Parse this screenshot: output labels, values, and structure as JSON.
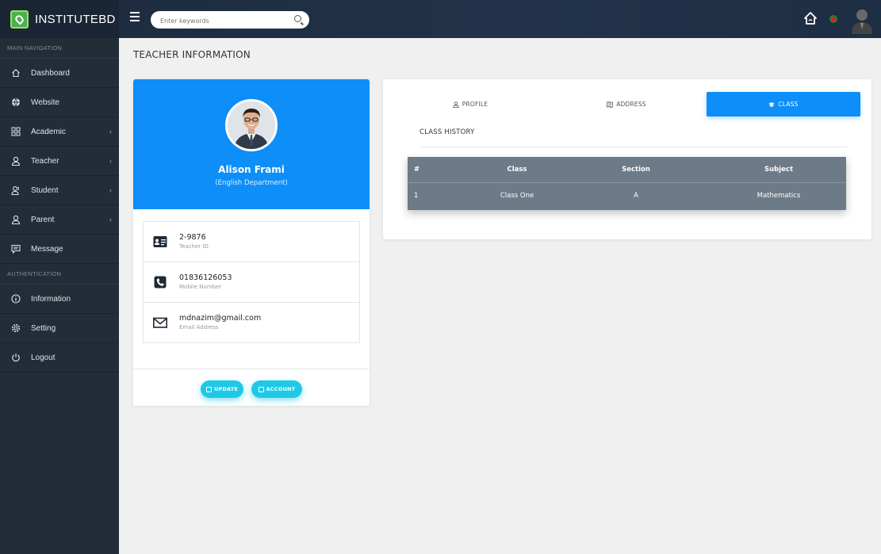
{
  "header": {
    "brand": "INSTITUTEBD",
    "search_placeholder": "Enter keywords",
    "colors": {
      "bar": "#1d2b3c",
      "flag_green": "#2e7d32",
      "flag_red": "#c62828"
    }
  },
  "sidebar": {
    "sections": [
      "MAIN NAVIGATION",
      "AUTHENTICATION"
    ],
    "items": [
      {
        "label": "Dashboard",
        "icon": "home-icon"
      },
      {
        "label": "Website",
        "icon": "globe-icon"
      },
      {
        "label": "Academic",
        "icon": "grid-icon",
        "expandable": true
      },
      {
        "label": "Teacher",
        "icon": "user-icon",
        "expandable": true
      },
      {
        "label": "Student",
        "icon": "users-icon",
        "expandable": true
      },
      {
        "label": "Parent",
        "icon": "user-icon",
        "expandable": true
      },
      {
        "label": "Message",
        "icon": "message-icon"
      },
      {
        "label": "Information",
        "icon": "info-icon"
      },
      {
        "label": "Setting",
        "icon": "gear-icon"
      },
      {
        "label": "Logout",
        "icon": "power-icon"
      }
    ]
  },
  "page": {
    "title": "TEACHER INFORMATION"
  },
  "profile": {
    "name": "Alison Frami",
    "department": "(English Department)",
    "teacher_id": "2-9876",
    "teacher_id_label": "Teacher ID",
    "mobile": "01836126053",
    "mobile_label": "Mobile Number",
    "email": "mdnazim@gmail.com",
    "email_label": "Email Address",
    "update_label": "UPDATE",
    "account_label": "ACCOUNT",
    "accent": "#0d8ef8",
    "button_color": "#1ec9e6"
  },
  "tabs": {
    "items": [
      {
        "label": "PROFILE",
        "icon": "user-icon"
      },
      {
        "label": "ADDRESS",
        "icon": "map-icon"
      },
      {
        "label": "CLASS",
        "icon": "graduation-icon",
        "active": true
      }
    ]
  },
  "class_history": {
    "title": "CLASS HISTORY",
    "columns": [
      "#",
      "Class",
      "Section",
      "Subject"
    ],
    "rows": [
      [
        "1",
        "Class One",
        "A",
        "Mathematics"
      ]
    ]
  }
}
